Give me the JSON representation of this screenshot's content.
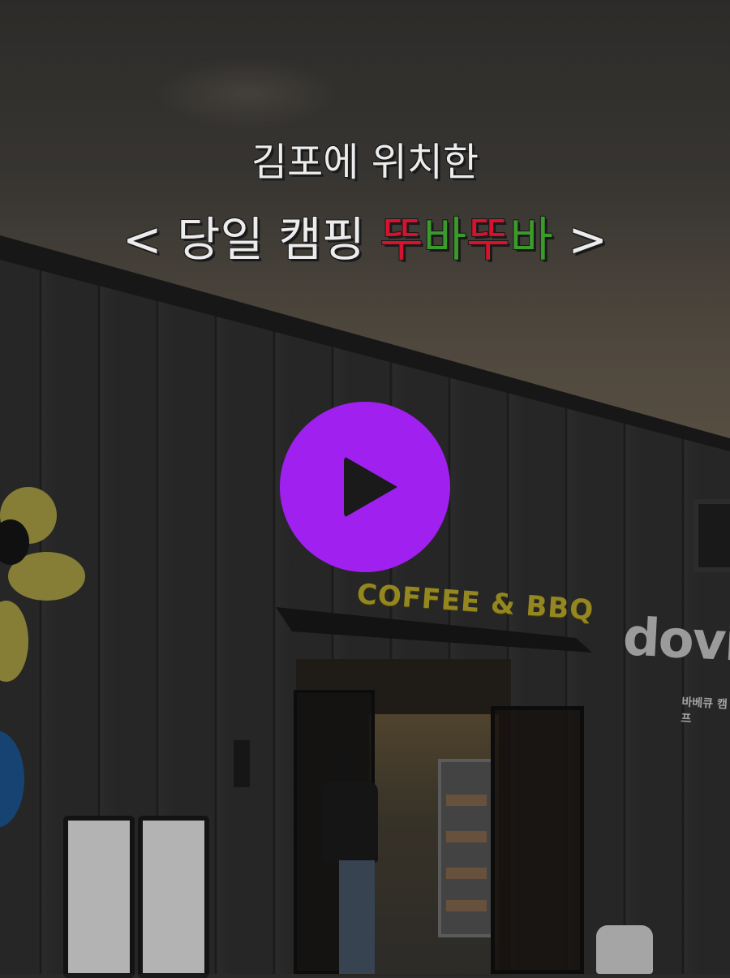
{
  "video": {
    "title_line1": "김포에 위치한",
    "title_line2_prefix": "< 당일 캠핑 ",
    "title_line2_highlight": [
      "뚜",
      "바",
      "뚜",
      "바"
    ],
    "title_line2_suffix": " >",
    "highlight_colors": [
      "#d6122f",
      "#3a9a2a"
    ],
    "play_button_color": "#a020f0",
    "play_icon": "play-icon"
  },
  "scene": {
    "storefront_sign": "COFFEE & BBQ",
    "brand_sign": "dovi",
    "brand_sub": "바베큐 캠프"
  }
}
